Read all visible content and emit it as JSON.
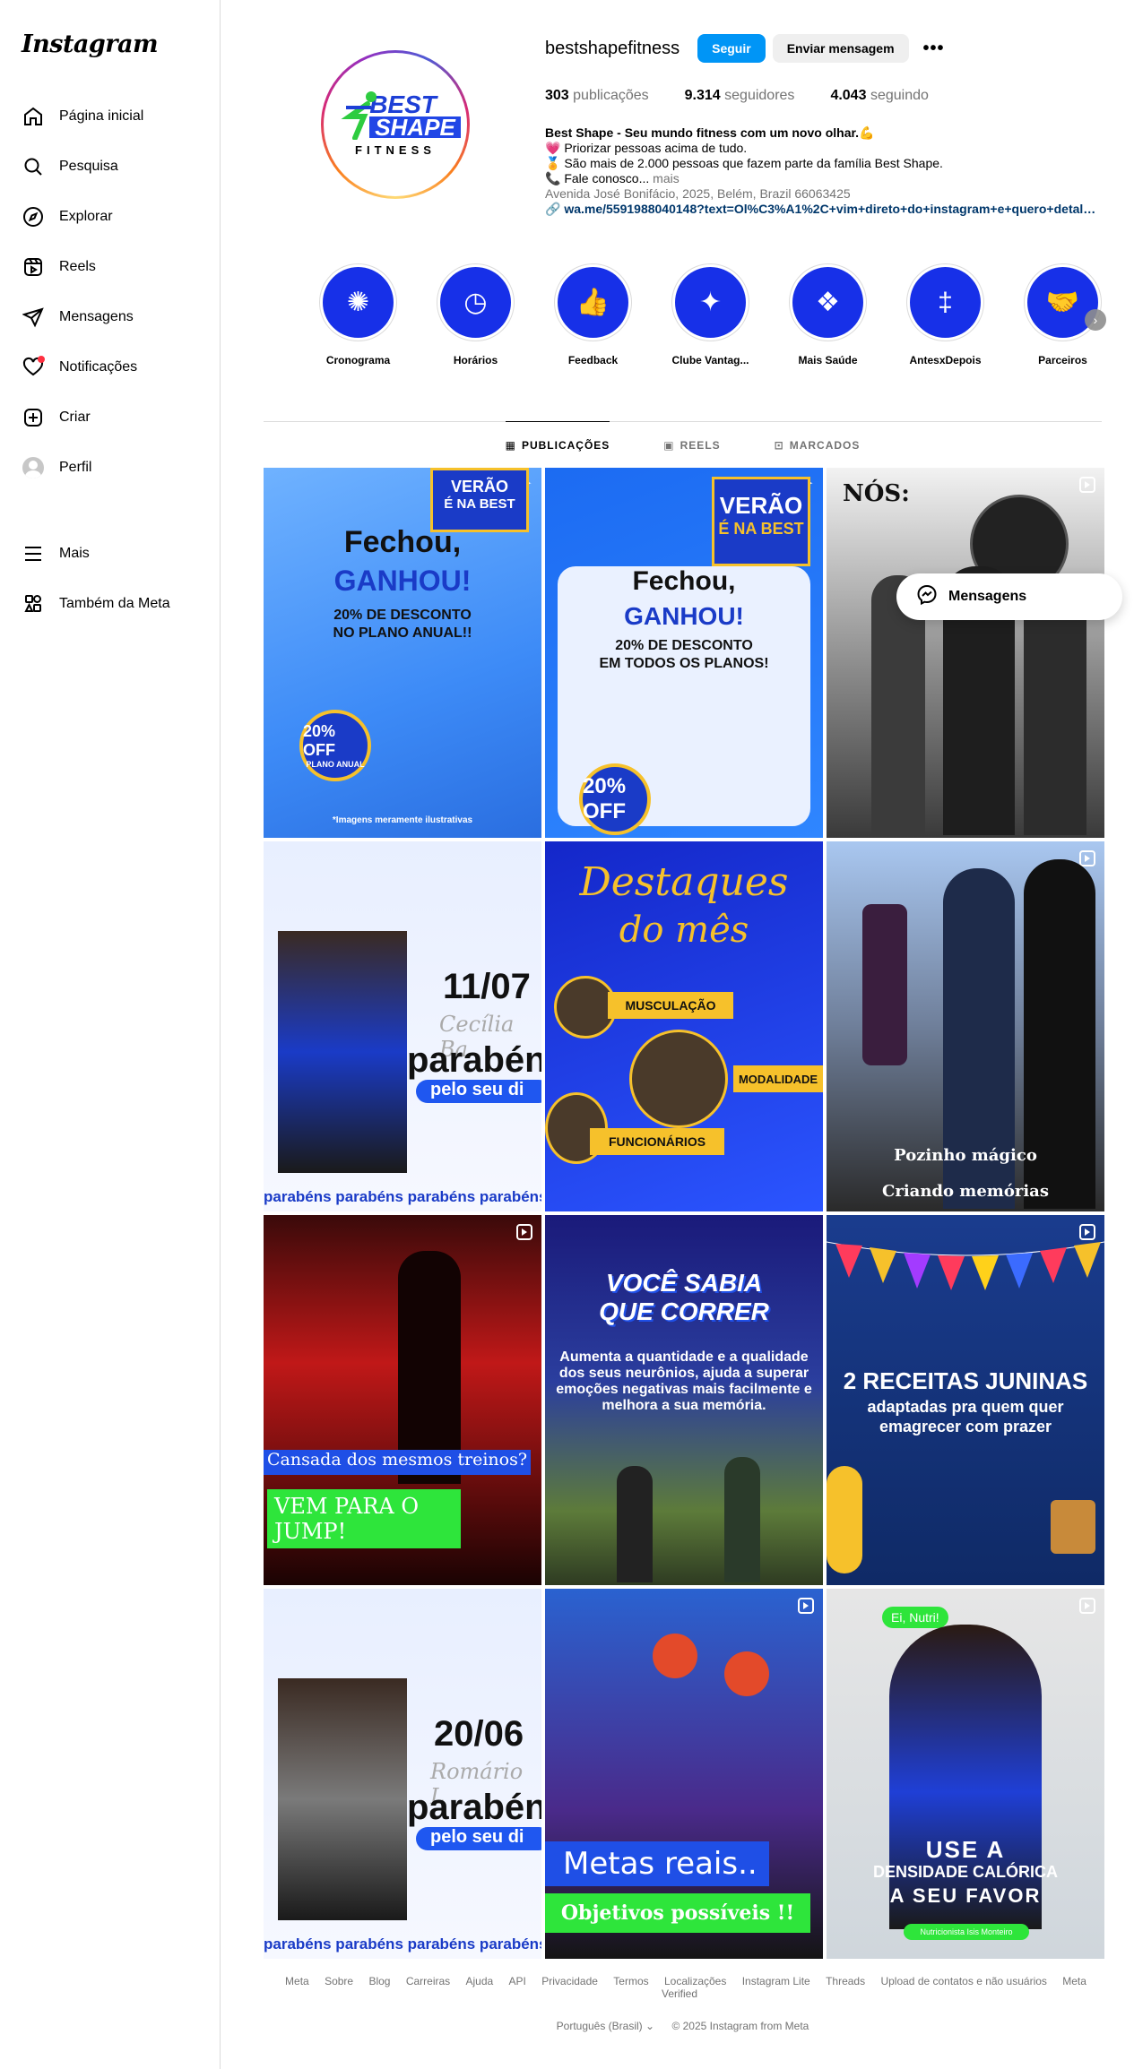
{
  "sidebar": {
    "logo": "Instagram",
    "items": [
      {
        "label": "Página inicial",
        "icon": "home-icon"
      },
      {
        "label": "Pesquisa",
        "icon": "search-icon"
      },
      {
        "label": "Explorar",
        "icon": "compass-icon"
      },
      {
        "label": "Reels",
        "icon": "reels-icon"
      },
      {
        "label": "Mensagens",
        "icon": "send-icon"
      },
      {
        "label": "Notificações",
        "icon": "heart-icon"
      },
      {
        "label": "Criar",
        "icon": "plus-square-icon"
      },
      {
        "label": "Perfil",
        "icon": "avatar"
      }
    ],
    "bottom": [
      {
        "label": "Mais",
        "icon": "menu-icon"
      },
      {
        "label": "Também da Meta",
        "icon": "meta-apps-icon"
      }
    ]
  },
  "profile": {
    "username": "bestshapefitness",
    "follow_label": "Seguir",
    "message_label": "Enviar mensagem",
    "more_label": "•••",
    "logo_line1": "BEST",
    "logo_line2": "SHAPE",
    "logo_line3": "FITNESS",
    "stats": {
      "posts_count": "303",
      "posts_label": "publicações",
      "followers_count": "9.314",
      "followers_label": "seguidores",
      "following_count": "4.043",
      "following_label": "seguindo"
    },
    "bio": {
      "name_line": "Best Shape - Seu mundo fitness com um novo olhar.💪",
      "line1": "💗 Priorizar pessoas acima de tudo.",
      "line2": "🏅 São mais de 2.000 pessoas que fazem parte da família Best Shape.",
      "line3": "📞 Fale conosco...",
      "more": " mais",
      "address": "Avenida José Bonifácio, 2025, Belém, Brazil 66063425",
      "link": "wa.me/5591988040148?text=Ol%C3%A1%2C+vim+direto+do+instagram+e+quero+detalhes..."
    }
  },
  "highlights": [
    {
      "label": "Cronograma",
      "icon": "✺"
    },
    {
      "label": "Horários",
      "icon": "◷"
    },
    {
      "label": "Feedback",
      "icon": "👍"
    },
    {
      "label": "Clube Vantag...",
      "icon": "✦"
    },
    {
      "label": "Mais Saúde",
      "icon": "❖"
    },
    {
      "label": "AntesxDepois",
      "icon": "‡"
    },
    {
      "label": "Parceiros",
      "icon": "🤝"
    }
  ],
  "tabs": [
    {
      "label": "PUBLICAÇÕES",
      "icon": "▦"
    },
    {
      "label": "REELS",
      "icon": "▣"
    },
    {
      "label": "MARCADOS",
      "icon": "⊡"
    }
  ],
  "posts": {
    "p1": {
      "l1": "VERÃO",
      "l2": "É NA BEST",
      "l3": "Fechou,",
      "l4": "GANHOU!",
      "l5": "20% DE DESCONTO",
      "l6": "NO PLANO ANUAL!!",
      "l7": "20% OFF",
      "l8": "PLANO ANUAL",
      "l9": "*Imagens meramente ilustrativas"
    },
    "p2": {
      "l1": "VERÃO",
      "l2": "É NA BEST",
      "l3": "Fechou,",
      "l4": "GANHOU!",
      "l5": "20% DE DESCONTO",
      "l6": "EM TODOS OS PLANOS!",
      "l7": "20% OFF"
    },
    "p3": {
      "l1": "NÓS:"
    },
    "p4": {
      "l1": "11/07",
      "l2": "Cecília Ba",
      "l3": "parabén",
      "l4": "pelo seu di",
      "l5": "parabéns parabéns parabéns parabéns"
    },
    "p5": {
      "l1": "Destaques",
      "l2": "do mês",
      "l3": "MUSCULAÇÃO",
      "l4": "MODALIDADE",
      "l5": "FUNCIONÁRIOS"
    },
    "p6": {
      "l1": "Pozinho mágico",
      "l2": "Criando memórias"
    },
    "p7": {
      "l1": "Cansada dos mesmos treinos?",
      "l2": "VEM PARA O JUMP!"
    },
    "p8": {
      "l1": "VOCÊ SABIA",
      "l2": "QUE CORRER",
      "l3": "Aumenta a quantidade e a qualidade dos seus neurônios, ajuda a superar emoções negativas mais facilmente e melhora a sua memória."
    },
    "p9": {
      "l1": "2 RECEITAS JUNINAS",
      "l2": "adaptadas pra quem quer",
      "l3": "emagrecer com prazer"
    },
    "p10": {
      "l1": "20/06",
      "l2": "Romário L",
      "l3": "parabén",
      "l4": "pelo seu di",
      "l5": "parabéns parabéns parabéns parabéns"
    },
    "p11": {
      "l1": "Metas reais..",
      "l2": "Objetivos possíveis !!"
    },
    "p12": {
      "l1": "Ei, Nutri!",
      "l2": "USE A",
      "l3": "DENSIDADE CALÓRICA",
      "l4": "A SEU FAVOR",
      "l5": "Nutricionista Isis Monteiro"
    }
  },
  "messages_pill": {
    "label": "Mensagens",
    "icon": "messenger-icon"
  },
  "footer": {
    "links": [
      "Meta",
      "Sobre",
      "Blog",
      "Carreiras",
      "Ajuda",
      "API",
      "Privacidade",
      "Termos",
      "Localizações",
      "Instagram Lite",
      "Threads",
      "Upload de contatos e não usuários",
      "Meta Verified"
    ],
    "language": "Português (Brasil)",
    "copyright": "© 2025 Instagram from Meta"
  },
  "colors": {
    "accent": "#0095f6",
    "brand_blue": "#1730e8",
    "notification": "#ff3040"
  }
}
